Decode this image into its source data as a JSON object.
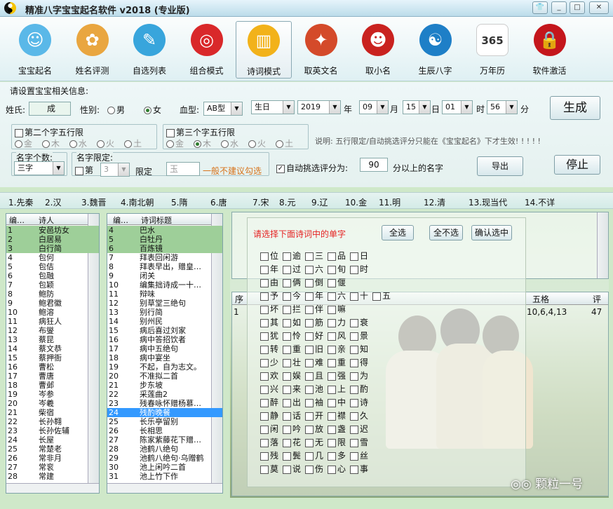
{
  "window": {
    "title": "精准八字宝宝起名软件 v2018 (专业版)"
  },
  "toolbar": [
    {
      "label": "宝宝起名",
      "icon": "baby-face-icon",
      "color": "#5ab8e8",
      "glyph": "☺"
    },
    {
      "label": "姓名评测",
      "icon": "score-badge-icon",
      "color": "#e9a640",
      "glyph": "✿"
    },
    {
      "label": "自选列表",
      "icon": "bird-reading-icon",
      "color": "#38a5dc",
      "glyph": "✎"
    },
    {
      "label": "组合模式",
      "icon": "red-lantern-icon",
      "color": "#d9282a",
      "glyph": "◎"
    },
    {
      "label": "诗词模式",
      "icon": "book-icon",
      "color": "#f2b21a",
      "glyph": "▥"
    },
    {
      "label": "取英文名",
      "icon": "russian-eagle-icon",
      "color": "#d44a2a",
      "glyph": "✦"
    },
    {
      "label": "取小名",
      "icon": "monkey-face-icon",
      "color": "#c9221f",
      "glyph": "☻"
    },
    {
      "label": "生辰八字",
      "icon": "yin-yang-icon",
      "color": "#1e7fc7",
      "glyph": "☯"
    },
    {
      "label": "万年历",
      "icon": "calendar-365-icon",
      "color": "#ffffff",
      "glyph": "365"
    },
    {
      "label": "软件激活",
      "icon": "lock-icon",
      "color": "#c4161c",
      "glyph": "🔒"
    }
  ],
  "form": {
    "section_title": "请设置宝宝相关信息:",
    "surname_label": "姓氏:",
    "surname_value": "成",
    "gender_label": "性别:",
    "male": "男",
    "female": "女",
    "blood_label": "血型:",
    "blood_value": "AB型",
    "birth_type": "生日",
    "year": "2019",
    "year_unit": "年",
    "month": "09",
    "month_unit": "月",
    "day": "15",
    "day_unit": "日",
    "hour": "01",
    "hour_unit": "时",
    "minute": "56",
    "minute_unit": "分",
    "generate_button": "生成",
    "second_char_label": "第二个字五行限",
    "third_char_label": "第三个字五行限",
    "elements": [
      "金",
      "木",
      "水",
      "火",
      "土"
    ],
    "note": "说明: 五行限定/自动挑选评分只能在《宝宝起名》下才生效! ! ! ! !",
    "name_count_label": "名字个数:",
    "name_count_value": "三字",
    "name_limit_label": "名字限定:",
    "di_label": "第",
    "di_value": "3",
    "limit_label": "限定",
    "limit_char": "玉",
    "limit_hint": "一般不建议勾选",
    "auto_score_label": "自动挑选评分为:",
    "auto_score_value": "90",
    "auto_score_suffix": "分以上的名字",
    "export_button": "导出",
    "stop_button": "停止"
  },
  "dynasties": [
    "1.先秦",
    "2.汉",
    "3.魏晋",
    "4.南北朝",
    "5.隋",
    "6.唐",
    "7.宋",
    "8.元",
    "9.辽",
    "10.金",
    "11.明",
    "12.清",
    "13.现当代",
    "14.不详"
  ],
  "poets": {
    "headers": [
      "编…",
      "诗人"
    ],
    "rows": [
      [
        "1",
        "安邑坊女"
      ],
      [
        "2",
        "白居易"
      ],
      [
        "3",
        "白行简"
      ],
      [
        "4",
        "包何"
      ],
      [
        "5",
        "包佶"
      ],
      [
        "6",
        "包融"
      ],
      [
        "7",
        "包颖"
      ],
      [
        "8",
        "鲍防"
      ],
      [
        "9",
        "鲍君徽"
      ],
      [
        "10",
        "鲍溶"
      ],
      [
        "11",
        "病狂人"
      ],
      [
        "12",
        "布燮"
      ],
      [
        "13",
        "蔡昆"
      ],
      [
        "14",
        "蔡文恭"
      ],
      [
        "15",
        "蔡押衙"
      ],
      [
        "16",
        "曹松"
      ],
      [
        "17",
        "曹唐"
      ],
      [
        "18",
        "曹邺"
      ],
      [
        "19",
        "岑参"
      ],
      [
        "20",
        "岑羲"
      ],
      [
        "21",
        "柴宿"
      ],
      [
        "22",
        "长孙翱"
      ],
      [
        "23",
        "长孙佐辅"
      ],
      [
        "24",
        "长屋"
      ],
      [
        "25",
        "常楚老"
      ],
      [
        "26",
        "常非月"
      ],
      [
        "27",
        "常衮"
      ],
      [
        "28",
        "常建"
      ]
    ]
  },
  "poems": {
    "headers": [
      "编…",
      "诗词标题"
    ],
    "rows": [
      [
        "4",
        "巴水"
      ],
      [
        "5",
        "白牡丹"
      ],
      [
        "6",
        "百炼镜"
      ],
      [
        "7",
        "拜表回闲游"
      ],
      [
        "8",
        "拜表早出，赠皇…"
      ],
      [
        "9",
        "闭关"
      ],
      [
        "10",
        "编集拙诗成一十…"
      ],
      [
        "11",
        "辩味"
      ],
      [
        "12",
        "别草堂三绝句"
      ],
      [
        "13",
        "别行简"
      ],
      [
        "14",
        "别州民"
      ],
      [
        "15",
        "病后喜过刘家"
      ],
      [
        "16",
        "病中答招饮者"
      ],
      [
        "17",
        "病中五绝句"
      ],
      [
        "18",
        "病中宴坐"
      ],
      [
        "19",
        "不起，自为志文。"
      ],
      [
        "20",
        "不准拟二首"
      ],
      [
        "21",
        "步东坡"
      ],
      [
        "22",
        "采莲曲2"
      ],
      [
        "23",
        "残春咏怀赠杨慕…"
      ],
      [
        "24",
        "残酌晚餐"
      ],
      [
        "25",
        "长乐亭留别"
      ],
      [
        "26",
        "长相思"
      ],
      [
        "27",
        "陈家紫藤花下赠…"
      ],
      [
        "28",
        "池鹤八绝句"
      ],
      [
        "29",
        "池鹤八绝句·乌赠鹤"
      ],
      [
        "30",
        "池上闲吟二首"
      ],
      [
        "31",
        "池上竹下作"
      ]
    ]
  },
  "popup": {
    "title": "请选择下面诗词中的单字",
    "select_all": "全选",
    "select_none": "全不选",
    "confirm": "确认选中",
    "grid": [
      [
        "位",
        "逾",
        "三",
        "品",
        "日"
      ],
      [
        "年",
        "过",
        "六",
        "旬",
        "时"
      ],
      [
        "由",
        "俩",
        "倒",
        "偃"
      ],
      [
        "予",
        "今",
        "年",
        "六",
        "十",
        "五"
      ],
      [
        "坏",
        "拦",
        "伴",
        "嘛"
      ],
      [
        "其",
        "如",
        "筋",
        "力",
        "衰"
      ],
      [
        "犹",
        "怜",
        "好",
        "风",
        "景"
      ],
      [
        "转",
        "重",
        "旧",
        "亲",
        "知"
      ],
      [
        "少",
        "壮",
        "难",
        "重",
        "得"
      ],
      [
        "欢",
        "娱",
        "且",
        "强",
        "为"
      ],
      [
        "兴",
        "来",
        "池",
        "上",
        "酌"
      ],
      [
        "醉",
        "出",
        "袖",
        "中",
        "诗"
      ],
      [
        "静",
        "话",
        "开",
        "襟",
        "久"
      ],
      [
        "闲",
        "吟",
        "放",
        "盏",
        "迟"
      ],
      [
        "落",
        "花",
        "无",
        "限",
        "雪"
      ],
      [
        "残",
        "鬓",
        "几",
        "多",
        "丝"
      ],
      [
        "莫",
        "说",
        "伤",
        "心",
        "事"
      ]
    ]
  },
  "results": {
    "headers": [
      "序",
      "五格",
      "评"
    ],
    "row": {
      "index": "1",
      "wuge": "10,6,4,13",
      "score": "47"
    }
  },
  "watermark": "颗粒一号"
}
